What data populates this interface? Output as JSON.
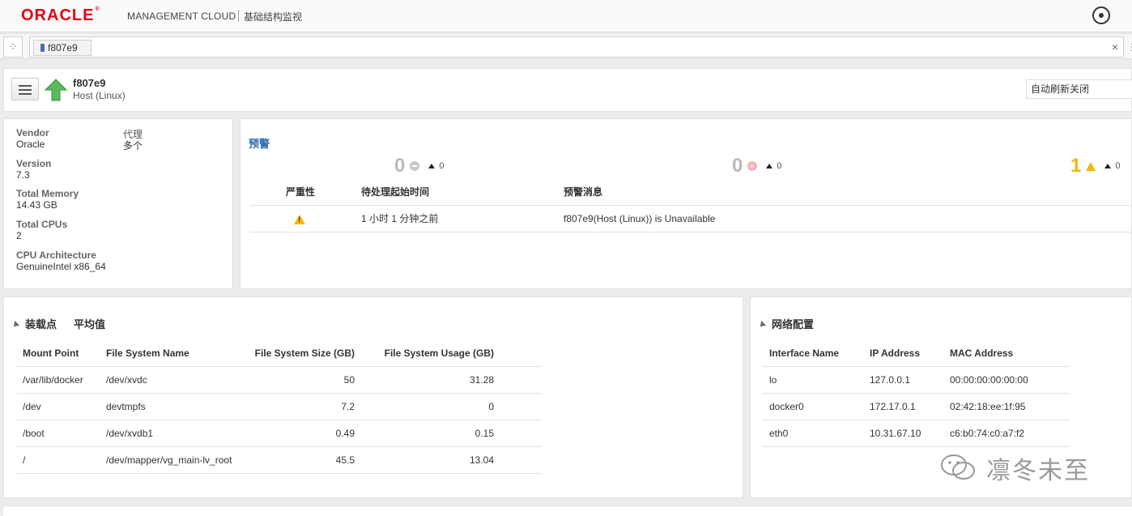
{
  "brand": {
    "logo": "ORACLE",
    "product": "MANAGEMENT CLOUD",
    "app_title": "基础结构监视"
  },
  "tabs": [
    {
      "label": "f807e9"
    }
  ],
  "header": {
    "entity_name": "f807e9",
    "entity_type": "Host (Linux)",
    "status": "up",
    "auto_refresh": "自动刷新关闭"
  },
  "summary": [
    {
      "label": "Vendor",
      "value": "Oracle"
    },
    {
      "label": "Version",
      "value": "7.3"
    },
    {
      "label": "Total Memory",
      "value": "14.43 GB"
    },
    {
      "label": "Total CPUs",
      "value": "2"
    },
    {
      "label": "CPU Architecture",
      "value": "GenuineIntel x86_64"
    }
  ],
  "agent": {
    "label": "代理",
    "value": "多个"
  },
  "alerts": {
    "title": "预警",
    "counts": [
      {
        "kind": "fatal",
        "value": "0",
        "delta": "0"
      },
      {
        "kind": "critical",
        "value": "0",
        "delta": "0"
      },
      {
        "kind": "warning",
        "value": "1",
        "delta": "0"
      }
    ],
    "columns": [
      "严重性",
      "待处理起始时间",
      "预警消息"
    ],
    "rows": [
      {
        "severity": "warning",
        "since": "1 小时 1 分钟之前",
        "message": "f807e9(Host (Linux)) is Unavailable"
      }
    ]
  },
  "mounts": {
    "title": "装载点",
    "subtitle": "平均值",
    "columns": [
      "Mount Point",
      "File System Name",
      "File System Size (GB)",
      "File System Usage (GB)"
    ],
    "rows": [
      {
        "mount": "/var/lib/docker",
        "fs": "/dev/xvdc",
        "size": "50",
        "usage": "31.28"
      },
      {
        "mount": "/dev",
        "fs": "devtmpfs",
        "size": "7.2",
        "usage": "0"
      },
      {
        "mount": "/boot",
        "fs": "/dev/xvdb1",
        "size": "0.49",
        "usage": "0.15"
      },
      {
        "mount": "/",
        "fs": "/dev/mapper/vg_main-lv_root",
        "size": "45.5",
        "usage": "13.04"
      }
    ]
  },
  "network": {
    "title": "网络配置",
    "columns": [
      "Interface Name",
      "IP Address",
      "MAC Address"
    ],
    "rows": [
      {
        "iface": "lo",
        "ip": "127.0.0.1",
        "mac": "00:00:00:00:00:00"
      },
      {
        "iface": "docker0",
        "ip": "172.17.0.1",
        "mac": "02:42:18:ee:1f:95"
      },
      {
        "iface": "eth0",
        "ip": "10.31.67.10",
        "mac": "c6:b0:74:c0:a7:f2"
      }
    ]
  },
  "watermark": "凛冬未至",
  "colors": {
    "oracle_red": "#e60012",
    "link_blue": "#2b6aa6",
    "warning_yellow": "#f5b800",
    "status_green": "#5cb85c"
  }
}
